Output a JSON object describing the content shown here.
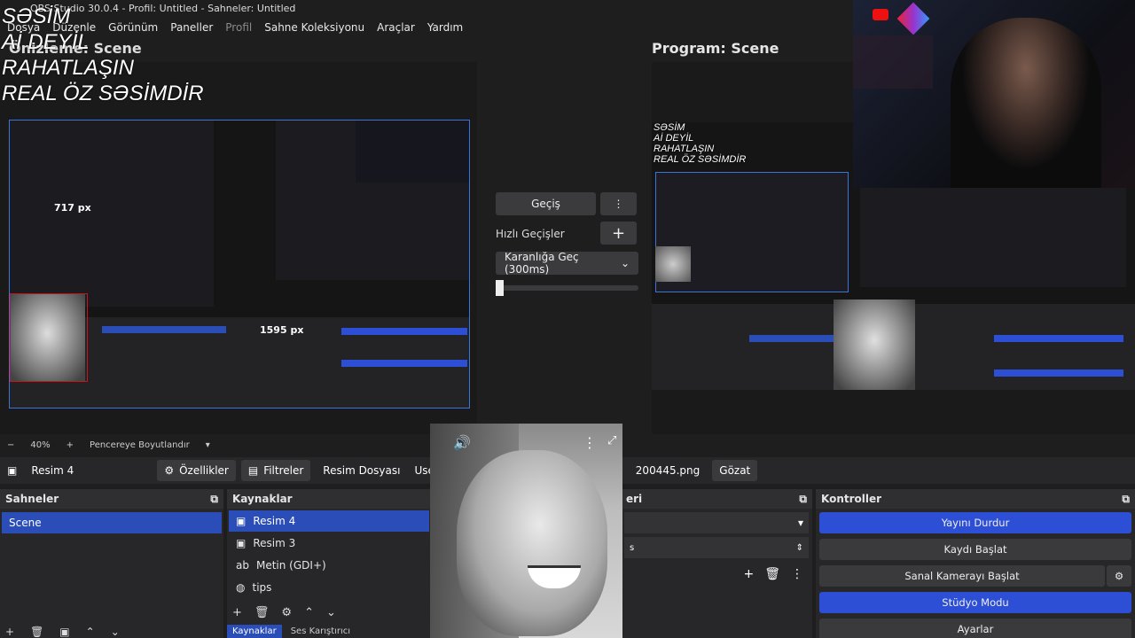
{
  "window": {
    "title": "OBS Studio 30.0.4 - Profil: Untitled - Sahneler: Untitled"
  },
  "menu": [
    "Dosya",
    "Düzenle",
    "Görünüm",
    "Paneller",
    "Profil",
    "Sahne Koleksiyonu",
    "Araçlar",
    "Yardım"
  ],
  "overlay": {
    "line1": "SƏSİM",
    "line2": "Aİ DEYİL",
    "line3": "RAHATLAŞIN",
    "line4": "REAL ÖZ SƏSİMDİR"
  },
  "preview": {
    "title": "Önizleme: Scene",
    "zoom": "40%",
    "fit_label": "Pencereye Boyutlandır",
    "width_label": "717 px",
    "height_label": "1595 px"
  },
  "program": {
    "title": "Program: Scene"
  },
  "transitions": {
    "transition_button": "Geçiş",
    "quick_label": "Hızlı Geçişler",
    "selected": "Karanlığa Geç (300ms)"
  },
  "source_toolbar": {
    "source_name": "Resim 4",
    "properties": "Özellikler",
    "filters": "Filtreler",
    "file_label": "Resim Dosyası",
    "path_start": "Users/m",
    "path_end": "200445.png",
    "browse": "Gözat"
  },
  "scenes": {
    "title": "Sahneler",
    "items": [
      "Scene"
    ]
  },
  "sources": {
    "title": "Kaynaklar",
    "items": [
      "Resim 4",
      "Resim 3",
      "Metin (GDI+)",
      "tips"
    ],
    "tab_sources": "Kaynaklar",
    "tab_mixer": "Ses Karıştırıcı"
  },
  "transitions_dock": {
    "title_fragment": "eri",
    "duration_fragment": "s"
  },
  "controls": {
    "title": "Kontroller",
    "stop_stream": "Yayını Durdur",
    "start_record": "Kaydı Başlat",
    "start_vcam": "Sanal Kamerayı Başlat",
    "studio_mode": "Stüdyo Modu",
    "settings": "Ayarlar"
  },
  "colors": {
    "accent": "#2d4fd6",
    "selection": "#2a4db8",
    "border_blue": "#3b74d8",
    "handle_red": "#c9141a"
  }
}
